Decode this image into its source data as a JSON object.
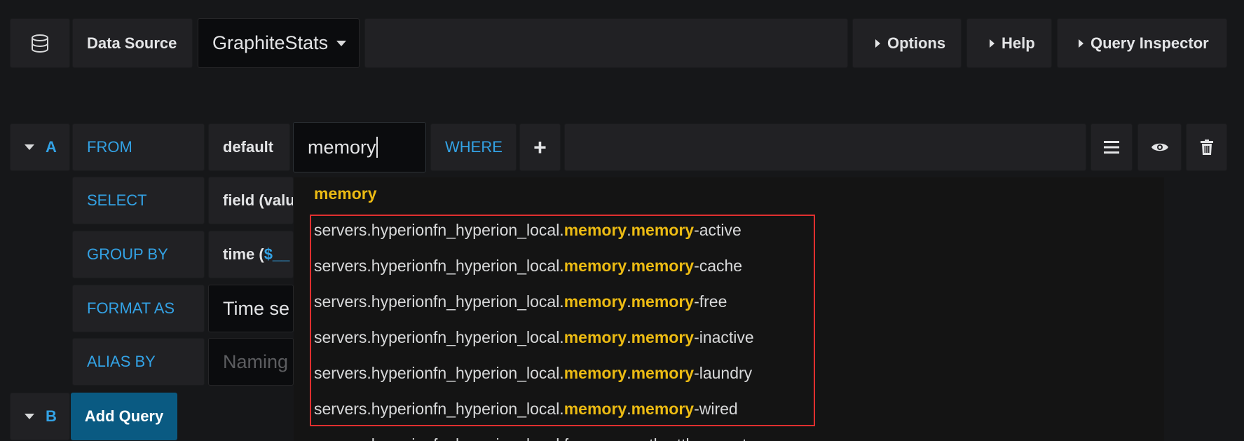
{
  "toolbar": {
    "datasource_label": "Data Source",
    "datasource_value": "GraphiteStats",
    "options_label": "Options",
    "help_label": "Help",
    "inspector_label": "Query Inspector"
  },
  "query_a": {
    "letter": "A",
    "from_label": "FROM",
    "from_policy": "default",
    "measurement_value": "memory",
    "where_label": "WHERE",
    "add_label": "+",
    "select_label": "SELECT",
    "select_value": "field (valu",
    "group_by_label": "GROUP BY",
    "group_by_prefix": "time (",
    "group_by_var": "$__",
    "format_label": "FORMAT AS",
    "format_value": "Time se",
    "alias_label": "ALIAS BY",
    "alias_placeholder": "Naming"
  },
  "query_b": {
    "letter": "B",
    "add_query_label": "Add Query"
  },
  "dropdown": {
    "header": "memory",
    "items": [
      {
        "prefix": "servers.hyperionfn_hyperion_local.",
        "m1": "memory",
        "dot": ".",
        "m2": "memory",
        "suffix": "-active"
      },
      {
        "prefix": "servers.hyperionfn_hyperion_local.",
        "m1": "memory",
        "dot": ".",
        "m2": "memory",
        "suffix": "-cache"
      },
      {
        "prefix": "servers.hyperionfn_hyperion_local.",
        "m1": "memory",
        "dot": ".",
        "m2": "memory",
        "suffix": "-free"
      },
      {
        "prefix": "servers.hyperionfn_hyperion_local.",
        "m1": "memory",
        "dot": ".",
        "m2": "memory",
        "suffix": "-inactive"
      },
      {
        "prefix": "servers.hyperionfn_hyperion_local.",
        "m1": "memory",
        "dot": ".",
        "m2": "memory",
        "suffix": "-laundry"
      },
      {
        "prefix": "servers.hyperionfn_hyperion_local.",
        "m1": "memory",
        "dot": ".",
        "m2": "memory",
        "suffix": "-wired"
      },
      {
        "prefix": "servers.hyperionfn_hyperion_local.fs.",
        "m1": "memory",
        "dot": "",
        "m2": "",
        "suffix": "-throttle_count"
      }
    ]
  },
  "colors": {
    "accent_blue": "#33a2e5",
    "match_yellow": "#ecbb13",
    "add_query_bg": "#0a5a82",
    "annotation_red": "#e02f2f"
  }
}
